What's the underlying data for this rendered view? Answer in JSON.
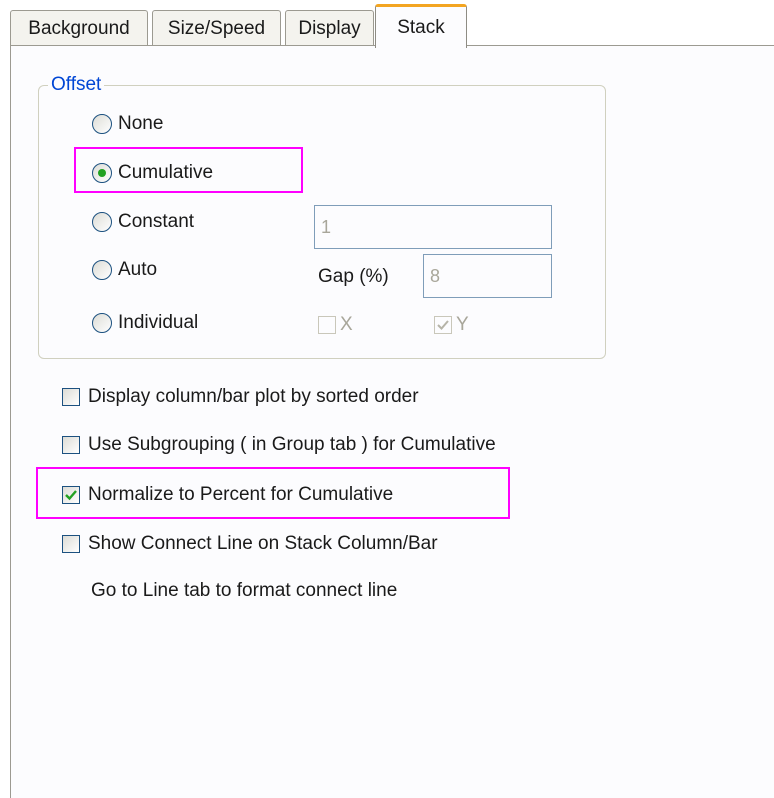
{
  "tabs": [
    {
      "label": "Background",
      "active": false
    },
    {
      "label": "Size/Speed",
      "active": false
    },
    {
      "label": "Display",
      "active": false
    },
    {
      "label": "Stack",
      "active": true
    }
  ],
  "offset_group": {
    "label": "Offset",
    "options": [
      {
        "label": "None",
        "selected": false
      },
      {
        "label": "Cumulative",
        "selected": true
      },
      {
        "label": "Constant",
        "selected": false
      },
      {
        "label": "Auto",
        "selected": false
      },
      {
        "label": "Individual",
        "selected": false
      }
    ],
    "constant_value": "1",
    "gap_label": "Gap (%)",
    "gap_value": "8",
    "x_label": "X",
    "x_checked": false,
    "y_label": "Y",
    "y_checked": true
  },
  "options": [
    {
      "label": "Display column/bar plot by sorted order",
      "checked": false
    },
    {
      "label": "Use Subgrouping ( in Group tab ) for Cumulative",
      "checked": false
    },
    {
      "label": "Normalize to Percent for Cumulative",
      "checked": true
    },
    {
      "label": "Show Connect Line on Stack Column/Bar",
      "checked": false
    }
  ],
  "connect_line_note": "Go to Line tab to format connect line",
  "colors": {
    "highlight": "#ff00ff",
    "active_tab_accent": "#f3a521",
    "group_label": "#0046d5",
    "radio_dot": "#21a121",
    "check_mark": "#21a121"
  }
}
